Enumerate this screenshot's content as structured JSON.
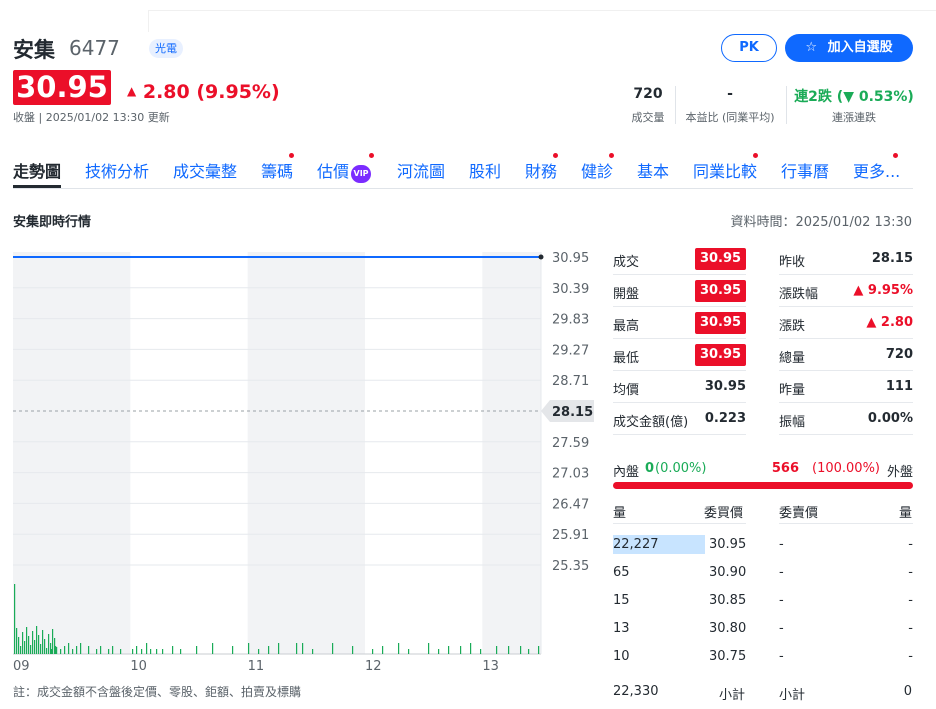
{
  "stock": {
    "name": "安集",
    "code": "6477",
    "tag": "光電",
    "price": "30.95",
    "change_arrow": "▲",
    "change": "2.80",
    "change_pct": "(9.95%)",
    "time_text": "收盤 | 2025/01/02 13:30 更新"
  },
  "buttons": {
    "pk": "PK",
    "add_icon": "☆",
    "add": "加入自選股"
  },
  "stats": [
    {
      "value": "720",
      "label": "成交量"
    },
    {
      "value": "-",
      "label": "本益比 (同業平均)"
    },
    {
      "value": "連2跌 (▼ 0.53%)",
      "label": "連漲連跌"
    }
  ],
  "nav": [
    {
      "label": "走勢圖",
      "active": true
    },
    {
      "label": "技術分析"
    },
    {
      "label": "成交彙整"
    },
    {
      "label": "籌碼",
      "dot": true
    },
    {
      "label": "估價",
      "vip": "VIP",
      "dot": true
    },
    {
      "label": "河流圖"
    },
    {
      "label": "股利"
    },
    {
      "label": "財務",
      "dot": true
    },
    {
      "label": "健診",
      "dot": true
    },
    {
      "label": "基本"
    },
    {
      "label": "同業比較",
      "dot": true
    },
    {
      "label": "行事曆"
    },
    {
      "label": "更多...",
      "dot": true
    }
  ],
  "section": {
    "title": "安集即時行情",
    "time": "資料時間：2025/01/02 13:30"
  },
  "chart_data": {
    "type": "line",
    "x_ticks": [
      "09",
      "10",
      "11",
      "12",
      "13"
    ],
    "y_ticks": [
      "30.95",
      "30.39",
      "29.83",
      "29.27",
      "28.71",
      "28.15",
      "27.59",
      "27.03",
      "26.47",
      "25.91",
      "25.35"
    ],
    "prev_close_label": "28.15",
    "ylim": [
      25.35,
      30.95
    ],
    "series": [
      {
        "x": [
          "09:00",
          "13:30"
        ],
        "values": [
          30.95,
          30.95
        ]
      }
    ],
    "line_color": "#0f69ff",
    "volume_color": "#1aab57"
  },
  "quote": {
    "left": [
      {
        "label": "成交",
        "value": "30.95",
        "box": true
      },
      {
        "label": "開盤",
        "value": "30.95",
        "box": true
      },
      {
        "label": "最高",
        "value": "30.95",
        "box": true
      },
      {
        "label": "最低",
        "value": "30.95",
        "box": true
      },
      {
        "label": "均價",
        "value": "30.95"
      },
      {
        "label": "成交金額(億)",
        "value": "0.223"
      }
    ],
    "right": [
      {
        "label": "昨收",
        "value": "28.15"
      },
      {
        "label": "漲跌幅",
        "value": "▲ 9.95%",
        "up": true
      },
      {
        "label": "漲跌",
        "value": "▲ 2.80",
        "up": true
      },
      {
        "label": "總量",
        "value": "720"
      },
      {
        "label": "昨量",
        "value": "111"
      },
      {
        "label": "振幅",
        "value": "0.00%"
      }
    ]
  },
  "inout": {
    "in_label": "內盤",
    "in_value": "0",
    "in_pct": "(0.00%)",
    "out_value": "566",
    "out_pct": "(100.00%)",
    "out_label": "外盤"
  },
  "orderbook": {
    "headers": [
      "量",
      "委買價",
      "委賣價",
      "量"
    ],
    "rows": [
      [
        "22,227",
        "30.95",
        "-",
        "-"
      ],
      [
        "65",
        "30.90",
        "-",
        "-"
      ],
      [
        "15",
        "30.85",
        "-",
        "-"
      ],
      [
        "13",
        "30.80",
        "-",
        "-"
      ],
      [
        "10",
        "30.75",
        "-",
        "-"
      ]
    ],
    "total": [
      "22,330",
      "小計",
      "小計",
      "0"
    ]
  },
  "footnote": "註：成交金額不含盤後定價、零股、鉅額、拍賣及標購"
}
